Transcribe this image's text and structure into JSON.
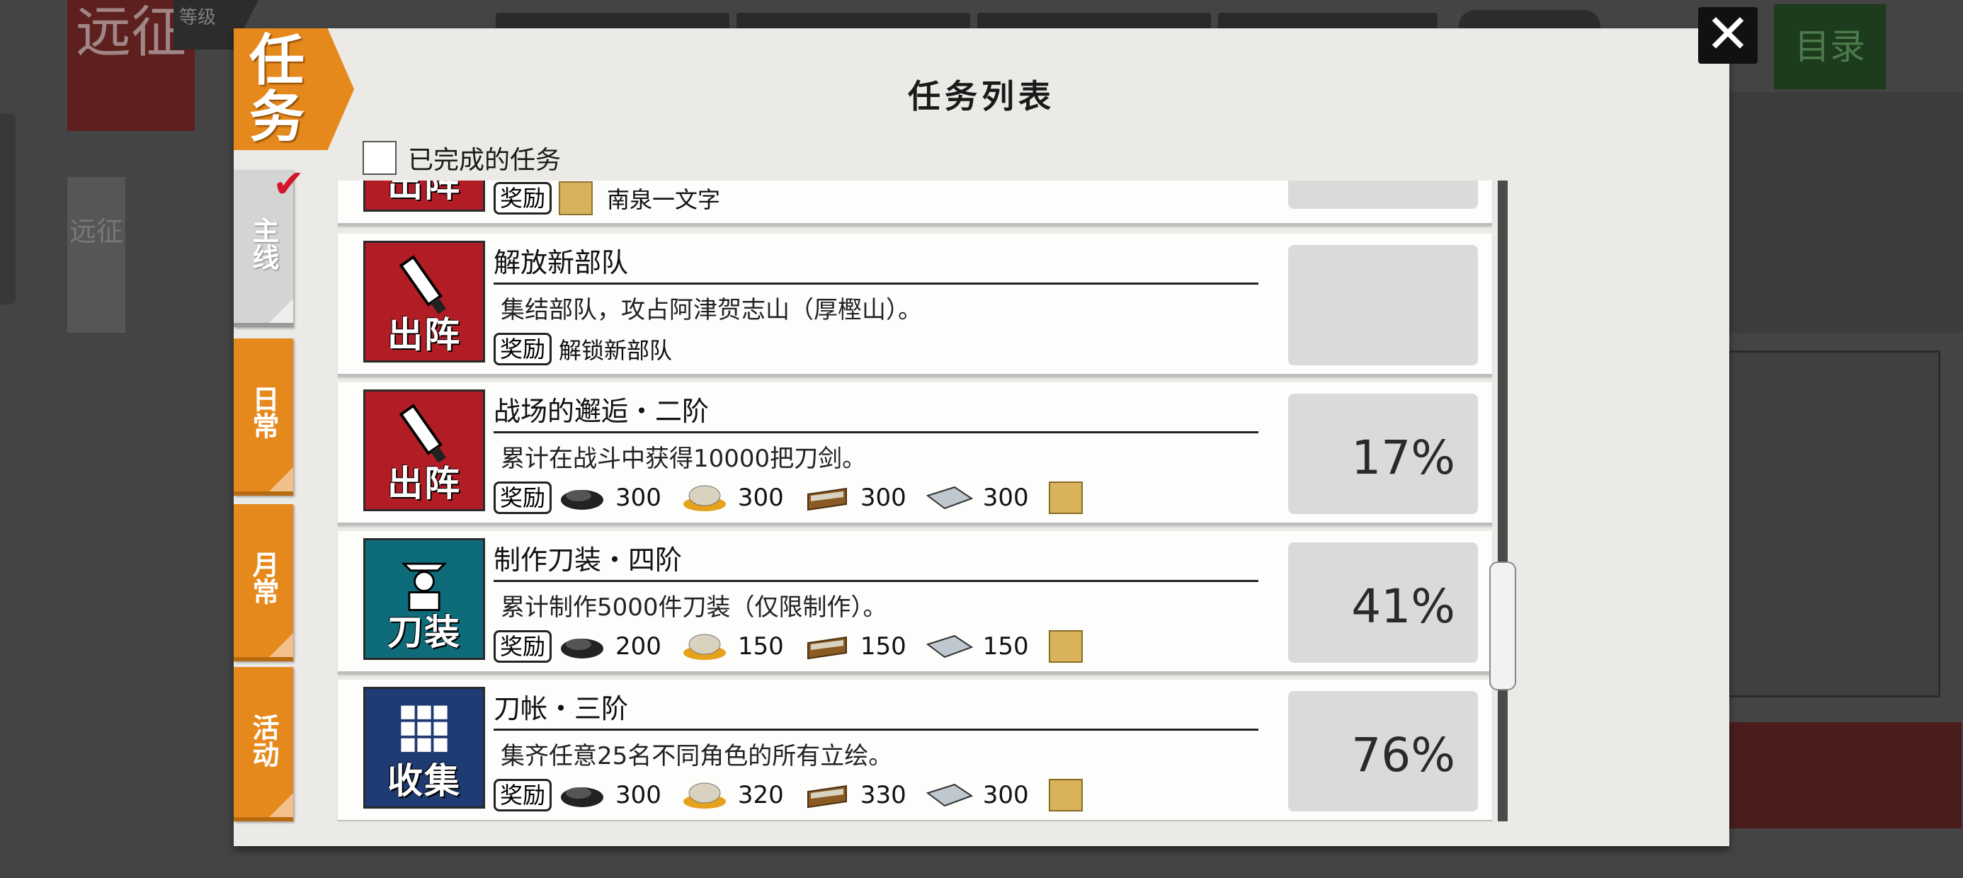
{
  "background": {
    "banner": "远征",
    "level_label": "等级",
    "side_tab": "远征",
    "menu_button": "目录"
  },
  "modal": {
    "title": "任务列表",
    "header_tab": "任务",
    "completed_filter_label": "已完成的任务",
    "completed_filter_checked": false
  },
  "tabs": [
    {
      "label": "主线",
      "active": true
    },
    {
      "label": "日常",
      "active": false
    },
    {
      "label": "月常",
      "active": false
    },
    {
      "label": "活动",
      "active": false
    }
  ],
  "quests": [
    {
      "badge": "出阵",
      "badge_color": "#b21d25",
      "title": "",
      "desc": "",
      "reward_label": "奖励",
      "reward_text": "南泉一文字",
      "progress": ""
    },
    {
      "badge": "出阵",
      "badge_color": "#b21d25",
      "title": "解放新部队",
      "desc": "集结部队，攻占阿津贺志山（厚樫山）。",
      "reward_label": "奖励",
      "reward_text": "解锁新部队",
      "progress": ""
    },
    {
      "badge": "出阵",
      "badge_color": "#b21d25",
      "title": "战场的邂逅・二阶",
      "desc": "累计在战斗中获得10000把刀剑。",
      "reward_label": "奖励",
      "resources": [
        "300",
        "300",
        "300",
        "300"
      ],
      "progress": "17%"
    },
    {
      "badge": "刀装",
      "badge_color": "#0d6b7a",
      "title": "制作刀装・四阶",
      "desc": "累计制作5000件刀装（仅限制作）。",
      "reward_label": "奖励",
      "resources": [
        "200",
        "150",
        "150",
        "150"
      ],
      "progress": "41%"
    },
    {
      "badge": "收集",
      "badge_color": "#1f3b73",
      "title": "刀帐・三阶",
      "desc": "集齐任意25名不同角色的所有立绘。",
      "reward_label": "奖励",
      "resources": [
        "300",
        "320",
        "330",
        "300"
      ],
      "progress": "76%"
    }
  ],
  "icons": {
    "close": "close-icon",
    "charcoal": "charcoal-icon",
    "steel": "tamahagane-icon",
    "coolant": "coolant-icon",
    "whetstone": "whetstone-icon",
    "ticket": "ticket-icon"
  }
}
